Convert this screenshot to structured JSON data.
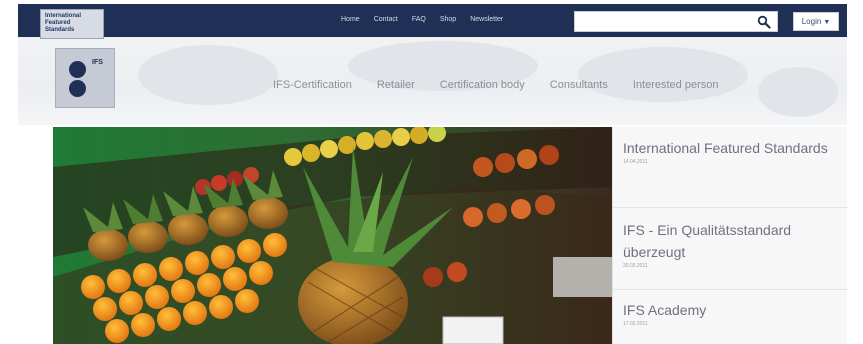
{
  "header_logo": {
    "line1": "International",
    "line2": "Featured",
    "line3": "Standards"
  },
  "topnav": [
    "Home",
    "Contact",
    "FAQ",
    "Shop",
    "Newsletter"
  ],
  "search": {
    "value": "",
    "placeholder": ""
  },
  "login": {
    "label": "Login",
    "icon": "caret-down-icon"
  },
  "ifs_logo": {
    "text": "IFS"
  },
  "mainnav": [
    "IFS-Certification",
    "Retailer",
    "Certification body",
    "Consultants",
    "Interested person"
  ],
  "news": [
    {
      "title": "International Featured Standards",
      "date": "14.04.2011"
    },
    {
      "title": "IFS - Ein Qualitätsstandard überzeugt",
      "date": "30.03.2011"
    },
    {
      "title": "IFS Academy",
      "date": "17.02.2011"
    }
  ],
  "colors": {
    "topbar": "#1f2f56",
    "header_bg": "#eceef1",
    "nav_text": "#8a8f99",
    "news_text": "#6c7280"
  }
}
